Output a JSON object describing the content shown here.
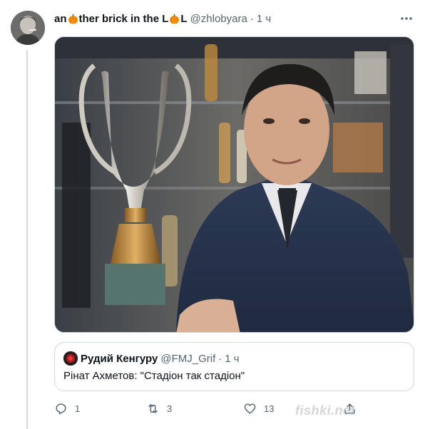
{
  "tweet": {
    "name_parts": [
      "an",
      "ther brick in the L",
      "L"
    ],
    "handle": "@zhlobyara",
    "separator": "·",
    "time": "1 ч"
  },
  "quote": {
    "name": "Рудий Кенгуру",
    "handle": "@FMJ_Grif",
    "separator": "·",
    "time": "1 ч",
    "text": "Рінат Ахметов: \"Стадіон так стадіон\""
  },
  "actions": {
    "reply_count": "1",
    "retweet_count": "3",
    "like_count": "13"
  },
  "watermark": "fishki.net"
}
